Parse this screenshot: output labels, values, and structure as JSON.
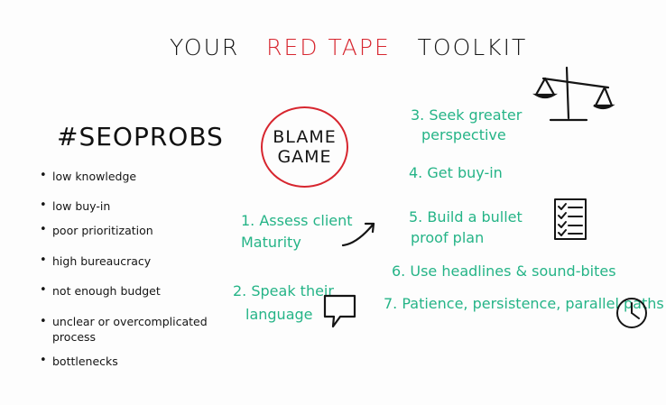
{
  "title": {
    "part1": "YOUR",
    "part2": "RED TAPE",
    "part3": "TOOLKIT"
  },
  "left": {
    "heading": "#SEOPROBS",
    "bullets": [
      "low knowledge",
      "low buy-in",
      "poor prioritization",
      "high bureaucracy",
      "not enough budget",
      "unclear or overcomplicated process",
      "bottlenecks"
    ]
  },
  "center": {
    "blame_line1": "BLAME",
    "blame_line2": "GAME"
  },
  "steps": {
    "s1_line1": "1. Assess client",
    "s1_line2": "Maturity",
    "s2_line1": "2. Speak their",
    "s2_line2": "language",
    "s3_line1": "3. Seek greater",
    "s3_line2": "perspective",
    "s4": "4. Get buy-in",
    "s5_line1": "5. Build a bullet",
    "s5_line2": "proof plan",
    "s6": "6. Use headlines & sound-bites",
    "s7": "7. Patience, persistence, parallel paths"
  },
  "colors": {
    "ink": "#151515",
    "red": "#d7262f",
    "green": "#25b487"
  },
  "icons": [
    "scale-icon",
    "trend-arrow-icon",
    "speech-bubble-icon",
    "checklist-icon",
    "clock-icon"
  ]
}
